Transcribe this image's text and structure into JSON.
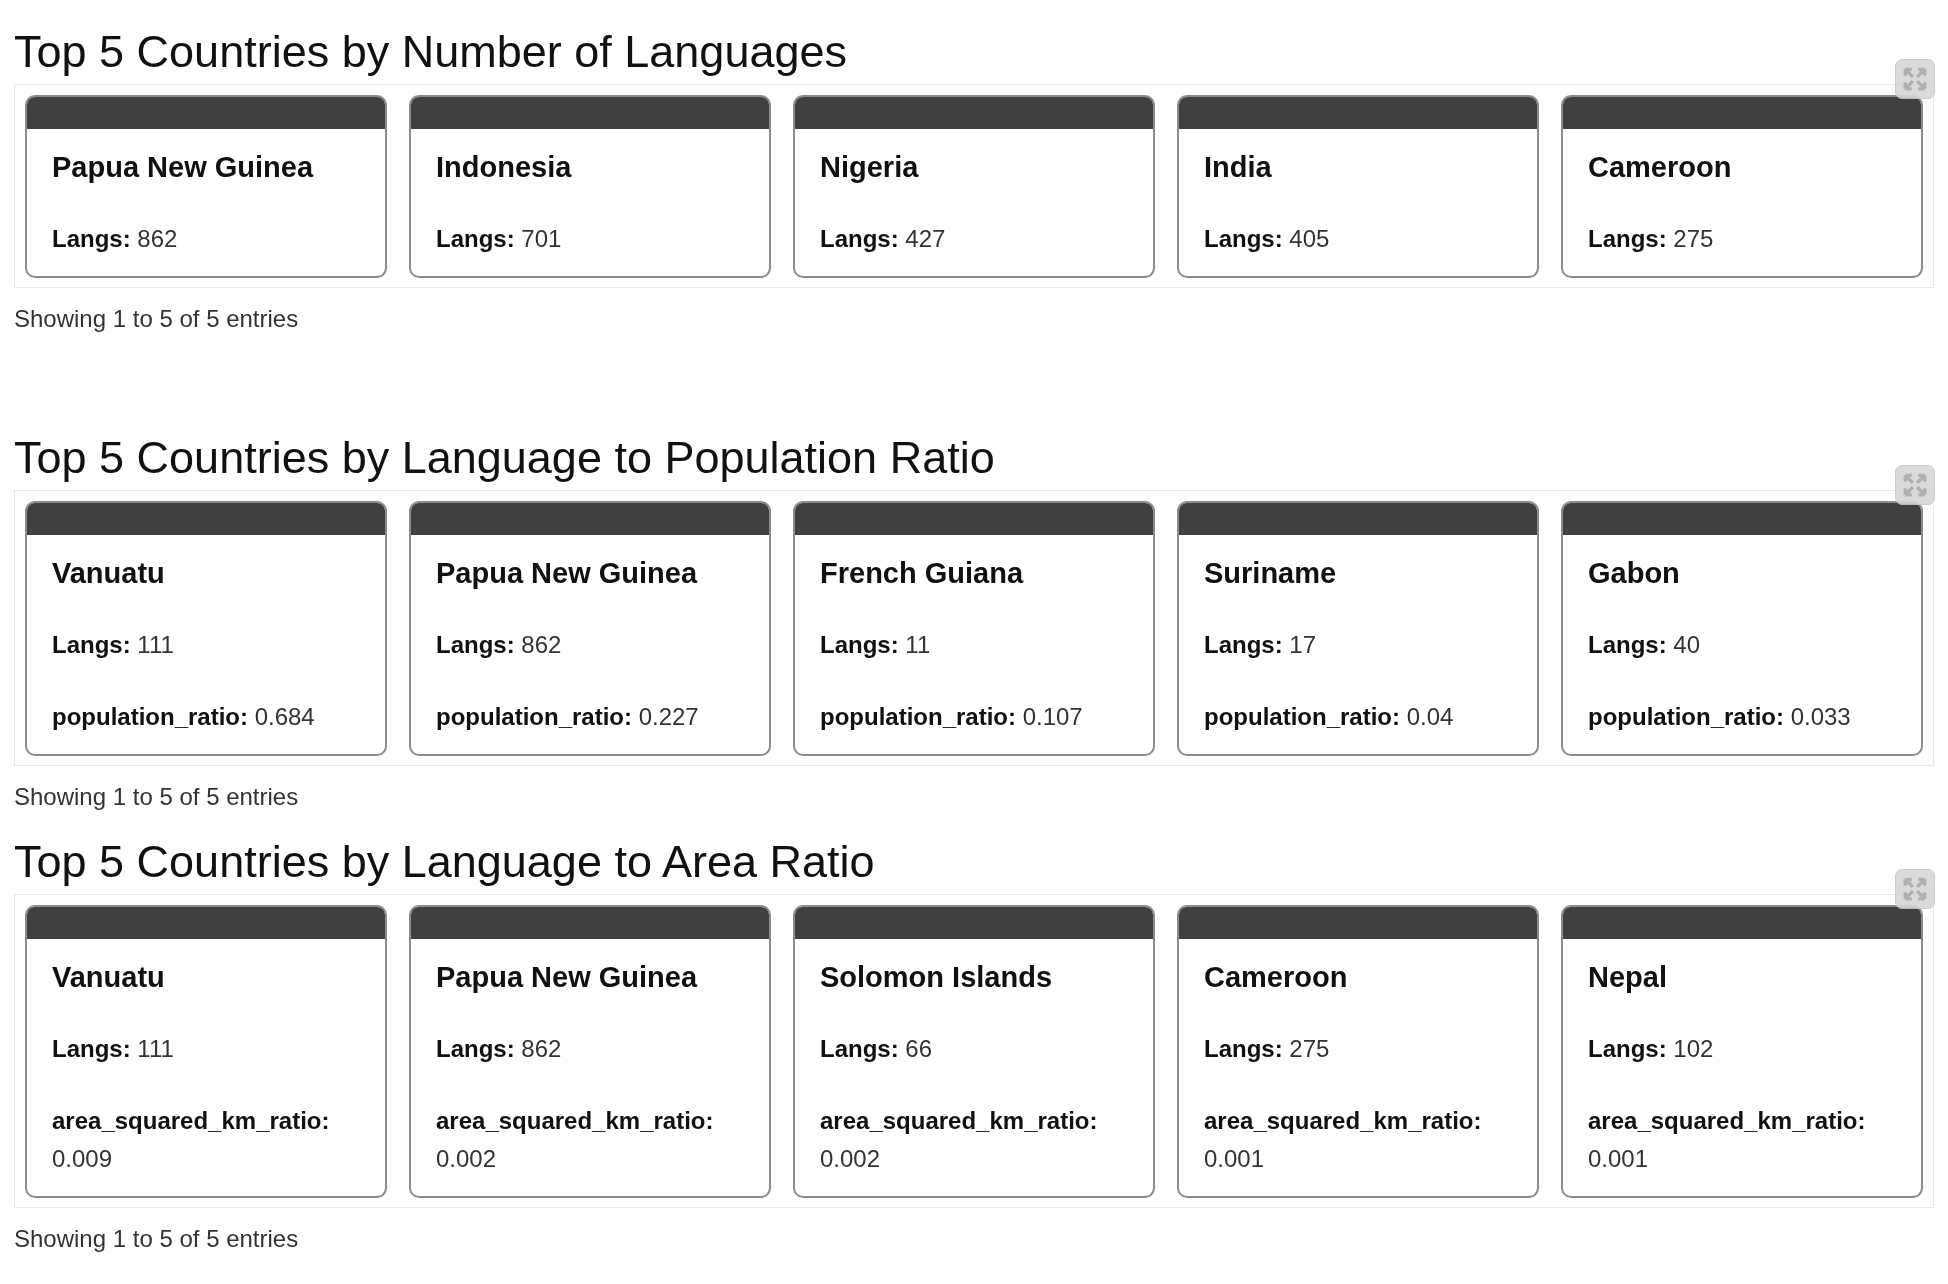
{
  "sections": [
    {
      "title": "Top 5 Countries by Number of Languages",
      "cards": [
        {
          "name": "Papua New Guinea",
          "fields": [
            "**Langs:** 862"
          ]
        },
        {
          "name": "Indonesia",
          "fields": [
            "**Langs:** 701"
          ]
        },
        {
          "name": "Nigeria",
          "fields": [
            "**Langs:** 427"
          ]
        },
        {
          "name": "India",
          "fields": [
            "**Langs:** 405"
          ]
        },
        {
          "name": "Cameroon",
          "fields": [
            "**Langs:** 275"
          ]
        }
      ],
      "footer": "Showing 1 to 5 of 5 entries"
    },
    {
      "title": "Top 5 Countries by Language to Population Ratio",
      "cards": [
        {
          "name": "Vanuatu",
          "fields": [
            "**Langs:** 111",
            "**population_ratio:** 0.684"
          ]
        },
        {
          "name": "Papua New Guinea",
          "fields": [
            "**Langs:** 862",
            "**population_ratio:** 0.227"
          ]
        },
        {
          "name": "French Guiana",
          "fields": [
            "**Langs:** 11",
            "**population_ratio:** 0.107"
          ]
        },
        {
          "name": "Suriname",
          "fields": [
            "**Langs:** 17",
            "**population_ratio:** 0.04"
          ]
        },
        {
          "name": "Gabon",
          "fields": [
            "**Langs:** 40",
            "**population_ratio:** 0.033"
          ]
        }
      ],
      "footer": "Showing 1 to 5 of 5 entries"
    },
    {
      "title": "Top 5 Countries by Language to Area Ratio",
      "cards": [
        {
          "name": "Vanuatu",
          "fields": [
            "**Langs:** 111",
            "**area_squared_km_ratio:** 0.009"
          ]
        },
        {
          "name": "Papua New Guinea",
          "fields": [
            "**Langs:** 862",
            "**area_squared_km_ratio:** 0.002"
          ]
        },
        {
          "name": "Solomon Islands",
          "fields": [
            "**Langs:** 66",
            "**area_squared_km_ratio:** 0.002"
          ]
        },
        {
          "name": "Cameroon",
          "fields": [
            "**Langs:** 275",
            "**area_squared_km_ratio:** 0.001"
          ]
        },
        {
          "name": "Nepal",
          "fields": [
            "**Langs:** 102",
            "**area_squared_km_ratio:** 0.001"
          ]
        }
      ],
      "footer": "Showing 1 to 5 of 5 entries"
    }
  ]
}
